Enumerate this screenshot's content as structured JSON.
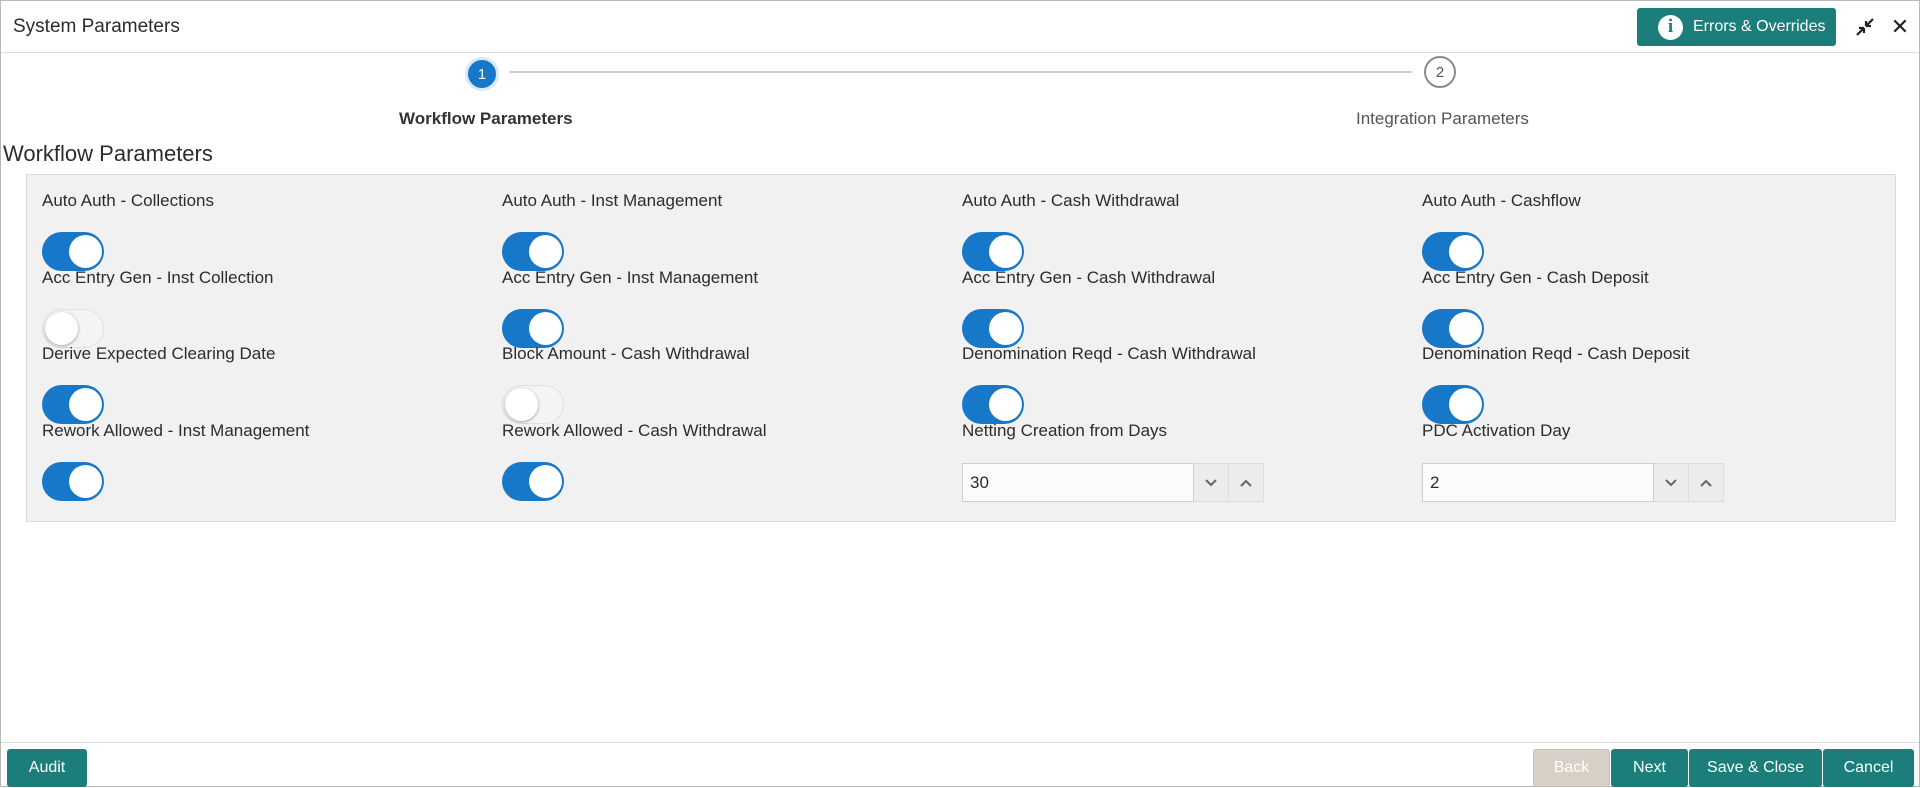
{
  "window": {
    "title": "System Parameters"
  },
  "header": {
    "errors_label": "Errors & Overrides"
  },
  "stepper": {
    "steps": [
      {
        "number": "1",
        "label": "Workflow Parameters",
        "active": true
      },
      {
        "number": "2",
        "label": "Integration Parameters",
        "active": false
      }
    ]
  },
  "section": {
    "title": "Workflow Parameters"
  },
  "fields": [
    {
      "label": "Auto Auth - Collections",
      "type": "toggle",
      "on": true
    },
    {
      "label": "Auto Auth - Inst Management",
      "type": "toggle",
      "on": true
    },
    {
      "label": "Auto Auth - Cash Withdrawal",
      "type": "toggle",
      "on": true
    },
    {
      "label": "Auto Auth - Cashflow",
      "type": "toggle",
      "on": true
    },
    {
      "label": "Acc Entry Gen - Inst Collection",
      "type": "toggle",
      "on": false
    },
    {
      "label": "Acc Entry Gen - Inst Management",
      "type": "toggle",
      "on": true
    },
    {
      "label": "Acc Entry Gen - Cash Withdrawal",
      "type": "toggle",
      "on": true
    },
    {
      "label": "Acc Entry Gen - Cash Deposit",
      "type": "toggle",
      "on": true
    },
    {
      "label": "Derive Expected Clearing Date",
      "type": "toggle",
      "on": true
    },
    {
      "label": "Block Amount - Cash Withdrawal",
      "type": "toggle",
      "on": false
    },
    {
      "label": "Denomination Reqd - Cash Withdrawal",
      "type": "toggle",
      "on": true
    },
    {
      "label": "Denomination Reqd - Cash Deposit",
      "type": "toggle",
      "on": true
    },
    {
      "label": "Rework Allowed - Inst Management",
      "type": "toggle",
      "on": true
    },
    {
      "label": "Rework Allowed - Cash Withdrawal",
      "type": "toggle",
      "on": true
    },
    {
      "label": "Netting Creation from Days",
      "type": "number",
      "value": "30"
    },
    {
      "label": "PDC Activation Day",
      "type": "number",
      "value": "2"
    }
  ],
  "footer": {
    "audit": "Audit",
    "back": "Back",
    "next": "Next",
    "save_close": "Save & Close",
    "cancel": "Cancel"
  },
  "colors": {
    "accent": "#1777c9",
    "primary_button": "#1b7e7a",
    "disabled_button": "#d8cfc6",
    "panel_bg": "#f1f1f1"
  }
}
